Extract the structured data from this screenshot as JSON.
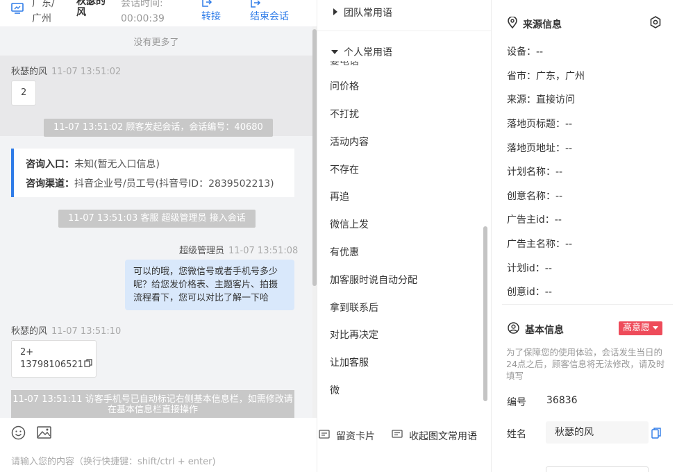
{
  "header": {
    "location": "广东/广州",
    "visitor_name": "秋瑟的风",
    "session_time_label": "会话时间:",
    "session_time": "00:00:39",
    "transfer_label": "转接",
    "end_label": "结束会话"
  },
  "chat": {
    "no_more": "没有更多了",
    "messages": [
      {
        "sender": "秋瑟的风",
        "time": "11-07 13:51:02",
        "text": "2"
      },
      {
        "system": "11-07 13:51:02 顾客发起会话，会话编号：40680"
      },
      {
        "entry_label": "咨询入口：",
        "entry_value": "未知(暂无入口信息)",
        "channel_label": "咨询渠道：",
        "channel_value": "抖音企业号/员工号(抖音号ID：2839502213)"
      },
      {
        "system": "11-07 13:51:03 客服 超级管理员 接入会话"
      },
      {
        "sender": "超级管理员",
        "time": "11-07 13:51:08",
        "text": "可以的哦，您微信号或者手机号多少呢？给您发价格表、主题客片、拍摄流程看下，您可以对比了解一下哈"
      },
      {
        "sender": "秋瑟的风",
        "time": "11-07 13:51:10",
        "line1": "2+",
        "line2": "13798106521"
      },
      {
        "system": "11-07 13:51:11 访客手机号已自动标记右侧基本信息栏，如需修改请在基本信息栏直接操作"
      }
    ]
  },
  "composer": {
    "card_button": "留资卡片",
    "collapse_button": "收起图文常用语",
    "placeholder": "请输入您的内容（换行快捷键：shift/ctrl + enter)"
  },
  "quick_replies": {
    "team_group": "团队常用语",
    "personal_group": "个人常用语",
    "cut_item": "要电话",
    "items": [
      "问价格",
      "不打扰",
      "活动内容",
      "不存在",
      "再追",
      "微信上发",
      "有优惠",
      "加客服时说自动分配",
      "拿到联系后",
      "对比再决定",
      "让加客服",
      "微"
    ]
  },
  "source_info": {
    "title": "来源信息",
    "rows": [
      {
        "label": "设备：",
        "value": "--"
      },
      {
        "label": "省市：",
        "value": "广东，广州"
      },
      {
        "label": "来源：",
        "value": "直接访问"
      },
      {
        "label": "落地页标题：",
        "value": "--"
      },
      {
        "label": "落地页地址：",
        "value": "--"
      },
      {
        "label": "计划名称：",
        "value": "--"
      },
      {
        "label": "创意名称：",
        "value": "--"
      },
      {
        "label": "广告主id：",
        "value": "--"
      },
      {
        "label": "广告主名称：",
        "value": "--"
      },
      {
        "label": "计划id：",
        "value": "--"
      },
      {
        "label": "创意id：",
        "value": "--"
      }
    ]
  },
  "basic_info": {
    "title": "基本信息",
    "intent_badge": "高意愿",
    "note": "为了保障您的使用体验，会话发生当日的24点之后，顾客信息将无法修改，请及时填写",
    "id_label": "编号",
    "id_value": "36836",
    "name_label": "姓名",
    "name_value": "秋瑟的风"
  },
  "colors": {
    "accent": "#2f7ce8",
    "badge": "#ee4b5a",
    "out_bubble": "#d9e8fb"
  }
}
